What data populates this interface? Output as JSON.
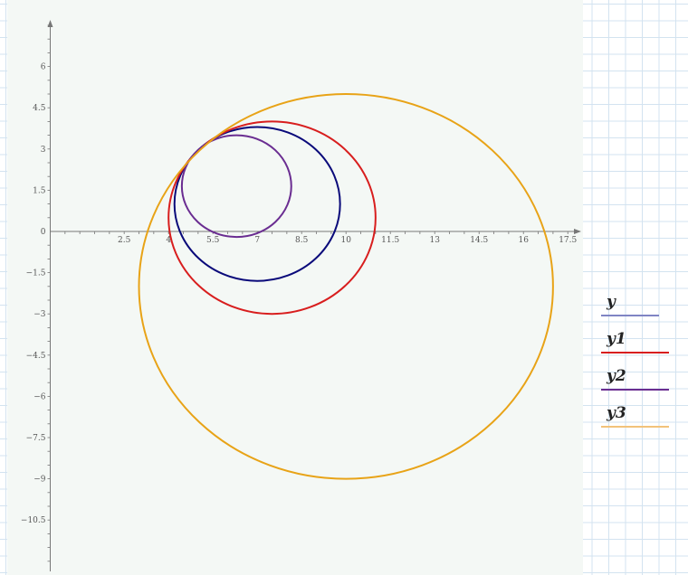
{
  "chart_data": {
    "type": "line",
    "title": "",
    "xlabel": "",
    "ylabel": "",
    "xlim": [
      -0.3,
      19.2
    ],
    "ylim": [
      -12.2,
      7.8
    ],
    "grid": false,
    "legend_position": "right",
    "x_ticks": [
      "2.5",
      "4",
      "5.5",
      "7",
      "8.5",
      "10",
      "11.5",
      "13",
      "14.5",
      "16",
      "17.5"
    ],
    "y_ticks": [
      "6",
      "4.5",
      "3",
      "1.5",
      "0",
      "-1.5",
      "-3",
      "-4.5",
      "-6",
      "-7.5",
      "-9",
      "-10.5"
    ],
    "series": [
      {
        "name": "y",
        "color": "#0a0a7a",
        "shape": "circle",
        "center": [
          7.0,
          1.0
        ],
        "radius": 2.8
      },
      {
        "name": "y1",
        "color": "#d81e1e",
        "shape": "circle",
        "center": [
          7.5,
          0.5
        ],
        "radius": 3.5
      },
      {
        "name": "y2",
        "color": "#6a2d91",
        "shape": "circle",
        "center": [
          6.3,
          1.65
        ],
        "radius": 1.85
      },
      {
        "name": "y3",
        "color": "#e8a317",
        "shape": "circle",
        "center": [
          10.0,
          -2.0
        ],
        "radius": 7.0
      }
    ],
    "legend_line_colors": [
      "#7f84c4",
      "#d81e1e",
      "#6a2d91",
      "#f2c27a"
    ]
  }
}
